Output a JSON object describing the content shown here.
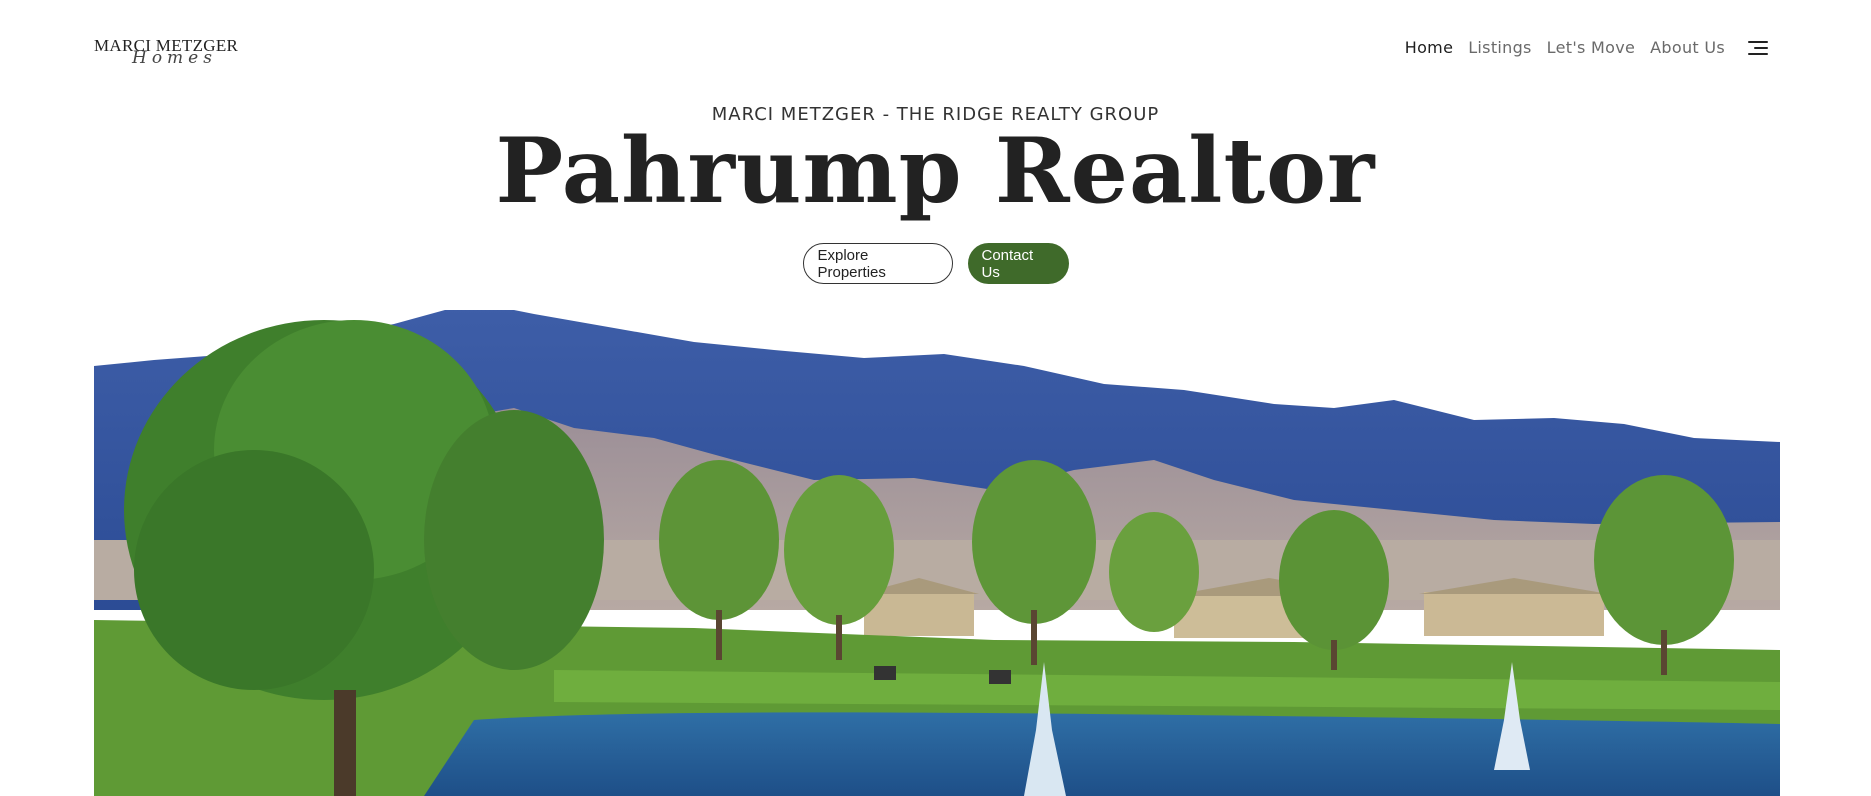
{
  "logo": {
    "name": "MARCI METZGER",
    "script": "Homes"
  },
  "nav": {
    "items": [
      "Home",
      "Listings",
      "Let's Move",
      "About Us"
    ],
    "menu_icon": "hamburger-menu-icon"
  },
  "hero": {
    "eyebrow": "MARCI METZGER - THE RIDGE REALTY GROUP",
    "title": "Pahrump Realtor",
    "explore_label": "Explore Properties",
    "contact_label": "Contact Us",
    "image": "mountain-golf-course-landscape"
  },
  "colors": {
    "accent": "#3f6a2a",
    "text": "#222222",
    "nav_muted": "#6a6a6a"
  }
}
